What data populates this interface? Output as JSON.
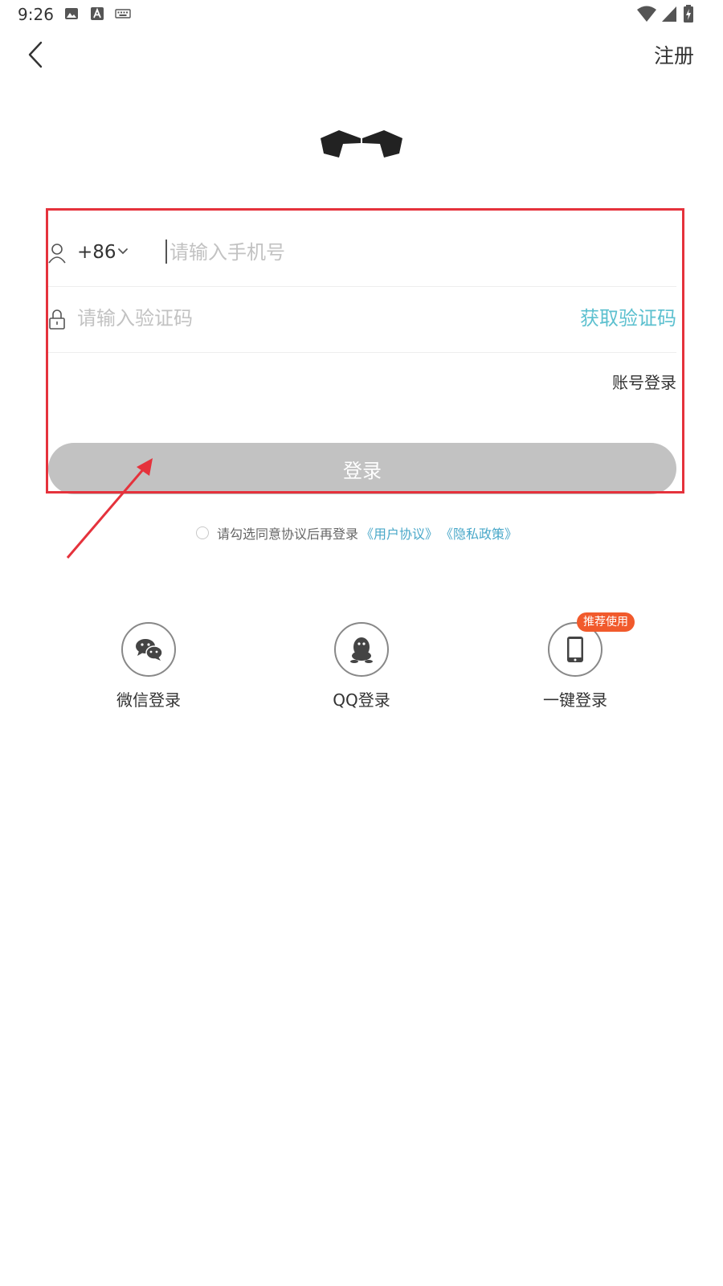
{
  "status_bar": {
    "time": "9:26",
    "left_icons": [
      "image-icon",
      "a-badge-icon",
      "keyboard-icon"
    ],
    "right_icons": [
      "wifi-icon",
      "cell-signal-icon",
      "battery-charging-icon"
    ]
  },
  "header": {
    "back_icon": "chevron-left-icon",
    "register_label": "注册"
  },
  "logo": {
    "icon": "brand-logo-icon"
  },
  "form": {
    "phone": {
      "icon": "user-icon",
      "country_code": "+86",
      "placeholder": "请输入手机号"
    },
    "code": {
      "icon": "lock-icon",
      "placeholder": "请输入验证码",
      "get_code_label": "获取验证码"
    },
    "account_login_label": "账号登录",
    "login_button_label": "登录"
  },
  "agreement": {
    "text": "请勾选同意协议后再登录",
    "user_agreement": "《用户协议》",
    "privacy_policy": "《隐私政策》"
  },
  "third_party": [
    {
      "icon": "wechat-icon",
      "label": "微信登录"
    },
    {
      "icon": "qq-icon",
      "label": "QQ登录"
    },
    {
      "icon": "phone-icon",
      "label": "一键登录",
      "badge": "推荐使用"
    }
  ],
  "colors": {
    "accent_teal": "#5cc0cf",
    "link_blue": "#4aa8c9",
    "button_disabled": "#c2c2c2",
    "badge": "#f15a2c",
    "annotation": "#e5323c"
  }
}
